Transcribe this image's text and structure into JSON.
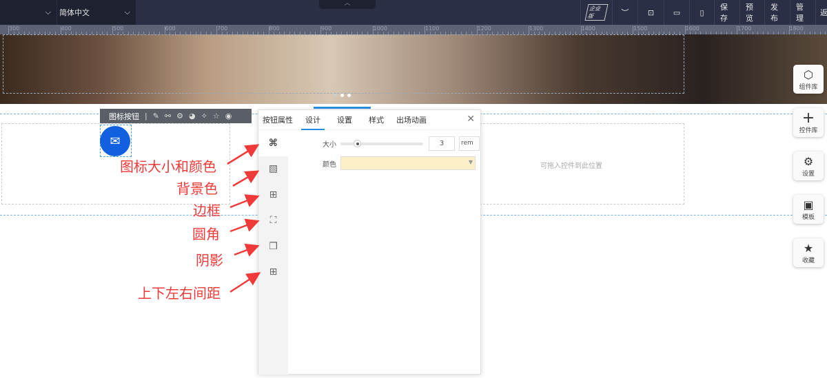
{
  "topbar": {
    "language": "简体中文",
    "edition_badge": "企业版",
    "items": [
      "保存",
      "预览",
      "发布",
      "管理",
      "返"
    ]
  },
  "ruler": {
    "labels": [
      "300",
      "400",
      "500",
      "600",
      "700",
      "800",
      "900",
      "1000",
      "1100",
      "1200",
      "1300",
      "1400",
      "1500",
      "1600",
      "1700",
      "1800"
    ]
  },
  "element_toolbar": {
    "title": "图标按钮"
  },
  "panel": {
    "tabs": [
      "按钮属性",
      "设计",
      "设置",
      "样式",
      "出场动画"
    ],
    "active_tab": "设计",
    "size_label": "大小",
    "size_value": "3",
    "size_unit": "rem",
    "size_fraction": 0.2,
    "color_label": "颜色",
    "color_value": "#fdefc8"
  },
  "annotations": [
    "图标大小和颜色",
    "背景色",
    "边框",
    "圆角",
    "阴影",
    "上下左右间距"
  ],
  "drop_hint": "可拖入控件到此位置",
  "rightbar": [
    "组件库",
    "控件库",
    "设置",
    "模板",
    "收藏"
  ]
}
